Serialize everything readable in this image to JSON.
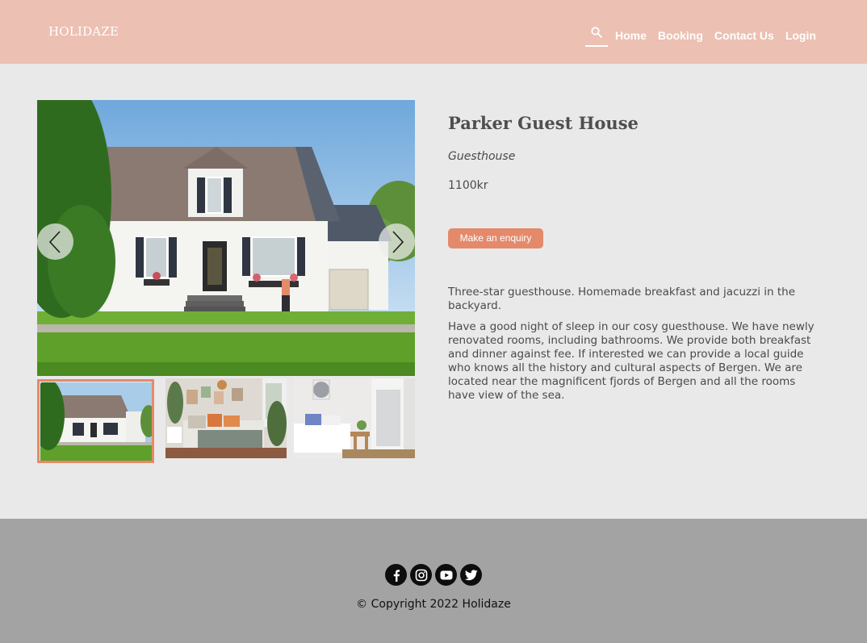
{
  "header": {
    "logo": "HOLIDAZE",
    "nav": [
      {
        "label": "Home"
      },
      {
        "label": "Booking"
      },
      {
        "label": "Contact Us"
      },
      {
        "label": "Login"
      }
    ],
    "search_icon": "search-icon"
  },
  "gallery": {
    "main_image": "house-exterior-photo",
    "thumbnails": [
      {
        "image": "house-exterior-photo",
        "selected": true
      },
      {
        "image": "bedroom-photo",
        "selected": false
      },
      {
        "image": "bright-bedroom-photo",
        "selected": false
      }
    ],
    "prev_icon": "chevron-left-icon",
    "next_icon": "chevron-right-icon"
  },
  "listing": {
    "name": "Parker Guest House",
    "type": "Guesthouse",
    "price": "1100kr",
    "enquiry_label": "Make an enquiry",
    "short_description": "Three-star guesthouse. Homemade breakfast and jacuzzi in the backyard.",
    "long_description": "Have a good night of sleep in our cosy guesthouse. We have newly renovated rooms, including bathrooms. We provide both breakfast and dinner against fee. If interested we can provide a local guide who knows all the history and cultural aspects of Bergen. We are located near the magnificent fjords of Bergen and all the rooms have view of the sea."
  },
  "footer": {
    "socials": [
      "facebook-icon",
      "instagram-icon",
      "youtube-icon",
      "twitter-icon"
    ],
    "copyright": "© Copyright 2022 Holidaze"
  },
  "colors": {
    "header_bg": "#ecc0b2",
    "accent": "#e48a6b",
    "page_bg": "#e9e9e9",
    "footer_bg": "#a3a3a3"
  }
}
